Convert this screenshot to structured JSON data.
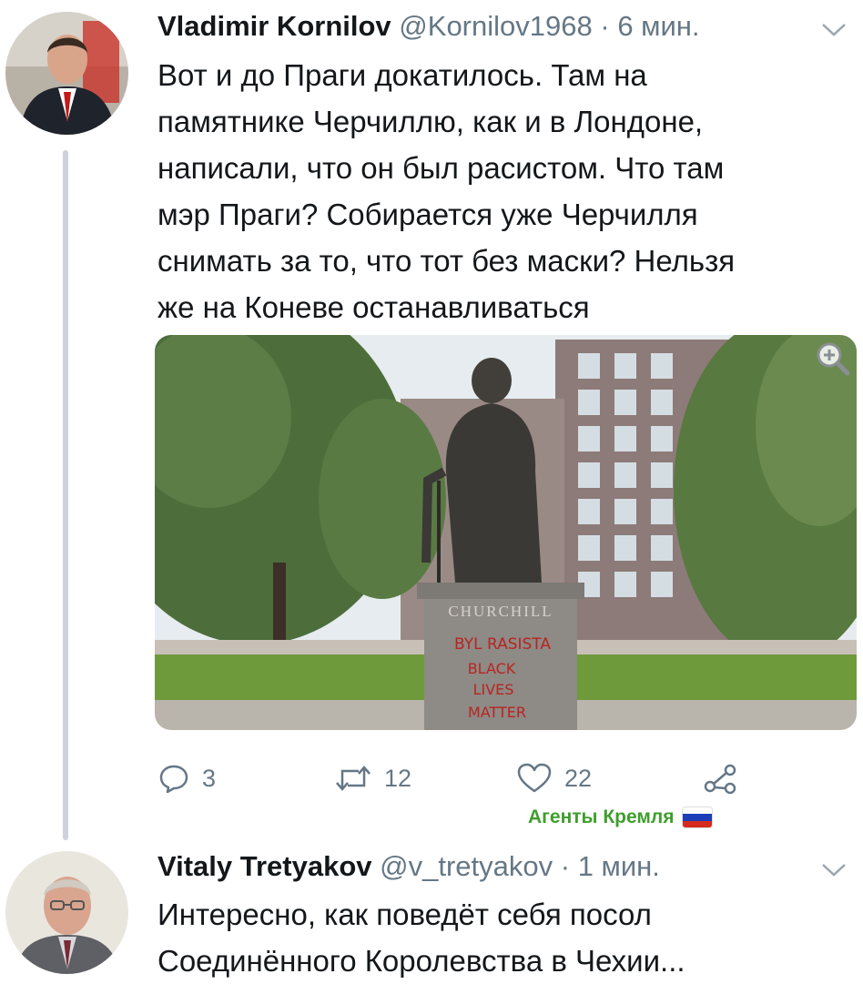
{
  "tweets": [
    {
      "name": "Vladimir Kornilov",
      "handle": "@Kornilov1968",
      "separator": "·",
      "time": "6 мин.",
      "text": "Вот и до Праги докатилось. Там на\nпамятнике Черчиллю, как и в Лондоне,\nнаписали, что он был расистом. Что там\nмэр Праги? Собирается уже Черчилля\nснимать за то, что тот без маски? Нельзя\nже на Коневе останавливаться",
      "image": {
        "pedestal_name": "CHURCHILL",
        "graffiti": [
          "BYL RASISTA",
          "BLACK",
          "LIVES",
          "MATTER"
        ]
      },
      "actions": {
        "replies": "3",
        "retweets": "12",
        "likes": "22"
      }
    },
    {
      "name": "Vitaly Tretyakov",
      "handle": "@v_tretyakov",
      "separator": "·",
      "time": "1 мин.",
      "text": "Интересно, как поведёт себя посол\nСоединённого Королевства в Чехии..."
    }
  ],
  "watermark": {
    "text": "Агенты Кремля",
    "flag_colors": [
      "#ffffff",
      "#1c3fb8",
      "#d52b1e"
    ]
  },
  "colors": {
    "text": "#14171a",
    "secondary": "#657786",
    "thread_line": "#cdd3d8",
    "watermark": "#3f9e2d"
  },
  "icons": [
    "reply-icon",
    "retweet-icon",
    "like-icon",
    "share-icon",
    "chevron-down-icon",
    "zoom-icon"
  ]
}
